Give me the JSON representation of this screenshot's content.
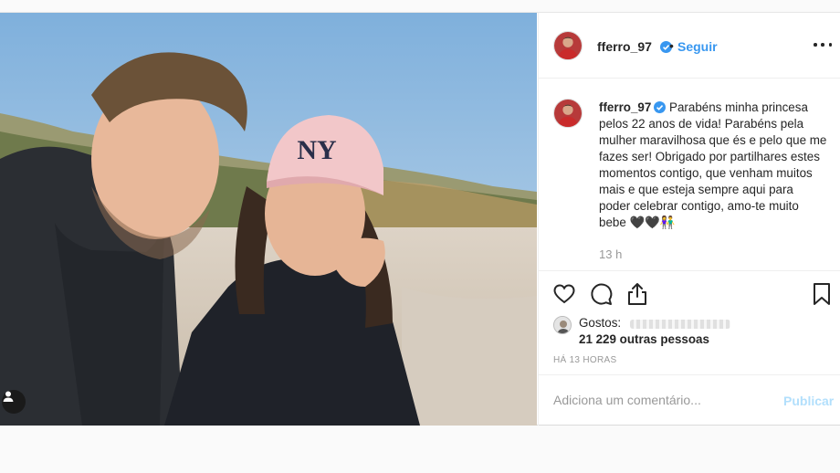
{
  "post": {
    "username": "fferro_97",
    "follow_label": "Seguir",
    "dot": "•",
    "caption": "Parabéns minha princesa pelos 22 anos de vida! Parabéns pela mulher maravilhosa que és e pelo que me fazes ser! Obrigado por partilhares estes momentos contigo, que venham muitos mais e que esteja sempre aqui para poder celebrar contigo, amo-te muito bebe 🖤🖤👫",
    "time": "13 h",
    "likes_prefix": "Gostos:",
    "likes_others": "21 229 outras pessoas",
    "posted_ago": "HÁ 13 HORAS",
    "comment_placeholder": "Adiciona um comentário...",
    "publish_label": "Publicar"
  },
  "icons": {
    "verified": "verified-badge-icon",
    "more": "more-options-icon",
    "like": "heart-icon",
    "comment": "comment-bubble-icon",
    "share": "share-icon",
    "save": "bookmark-icon",
    "tag": "user-tag-icon"
  },
  "colors": {
    "link_blue": "#3897f0",
    "publish_disabled": "#b2dffc",
    "muted_text": "#999999"
  }
}
